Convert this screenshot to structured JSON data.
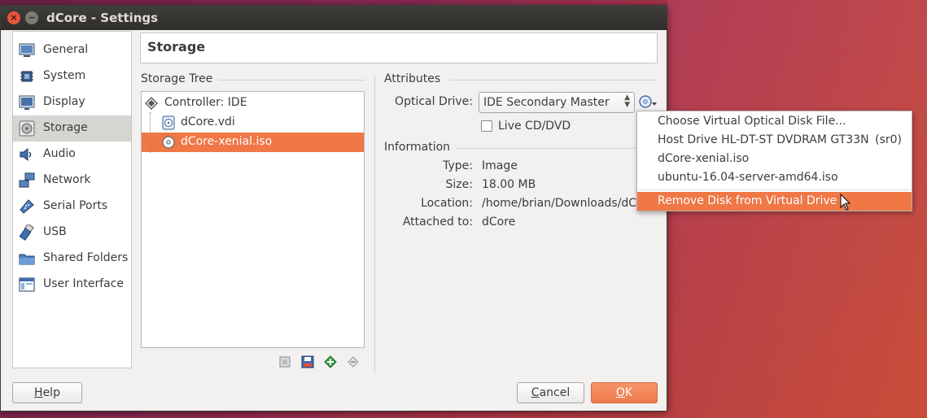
{
  "window": {
    "title": "dCore - Settings"
  },
  "sidebar": {
    "items": [
      {
        "label": "General",
        "icon": "general-icon"
      },
      {
        "label": "System",
        "icon": "system-icon"
      },
      {
        "label": "Display",
        "icon": "display-icon"
      },
      {
        "label": "Storage",
        "icon": "storage-icon",
        "selected": true
      },
      {
        "label": "Audio",
        "icon": "audio-icon"
      },
      {
        "label": "Network",
        "icon": "network-icon"
      },
      {
        "label": "Serial Ports",
        "icon": "serial-ports-icon"
      },
      {
        "label": "USB",
        "icon": "usb-icon"
      },
      {
        "label": "Shared Folders",
        "icon": "shared-folders-icon"
      },
      {
        "label": "User Interface",
        "icon": "user-interface-icon"
      }
    ]
  },
  "page": {
    "title": "Storage"
  },
  "storage_tree": {
    "label": "Storage Tree",
    "controller": "Controller: IDE",
    "items": [
      {
        "label": "dCore.vdi",
        "icon": "hard-disk-icon"
      },
      {
        "label": "dCore-xenial.iso",
        "icon": "optical-disk-icon",
        "selected": true
      }
    ],
    "toolbar": [
      "add-controller-icon",
      "remove-controller-icon",
      "add-attachment-icon",
      "remove-attachment-icon"
    ]
  },
  "attributes": {
    "label": "Attributes",
    "optical_drive_label": "Optical Drive:",
    "optical_drive_value": "IDE Secondary Master",
    "live_cd_label": "Live CD/DVD",
    "live_cd_checked": false
  },
  "information": {
    "label": "Information",
    "type_label": "Type:",
    "type_value": "Image",
    "size_label": "Size:",
    "size_value": "18.00 MB",
    "location_label": "Location:",
    "location_value": "/home/brian/Downloads/dC",
    "attached_label": "Attached to:",
    "attached_value": "dCore"
  },
  "menu": {
    "items": [
      {
        "label": "Choose Virtual Optical Disk File..."
      },
      {
        "label": "Host Drive HL-DT-ST DVDRAM GT33N",
        "extra": "(sr0)"
      },
      {
        "label": "dCore-xenial.iso"
      },
      {
        "label": "ubuntu-16.04-server-amd64.iso"
      },
      {
        "label": "Remove Disk from Virtual Drive",
        "highlight": true
      }
    ]
  },
  "buttons": {
    "help_mnemonic": "H",
    "help_rest": "elp",
    "cancel_mnemonic": "C",
    "cancel_rest": "ancel",
    "ok_mnemonic": "O",
    "ok_rest": "K"
  },
  "colors": {
    "accent": "#f07746",
    "titlebar": "#3a3935",
    "window_bg": "#f2f1f0"
  }
}
